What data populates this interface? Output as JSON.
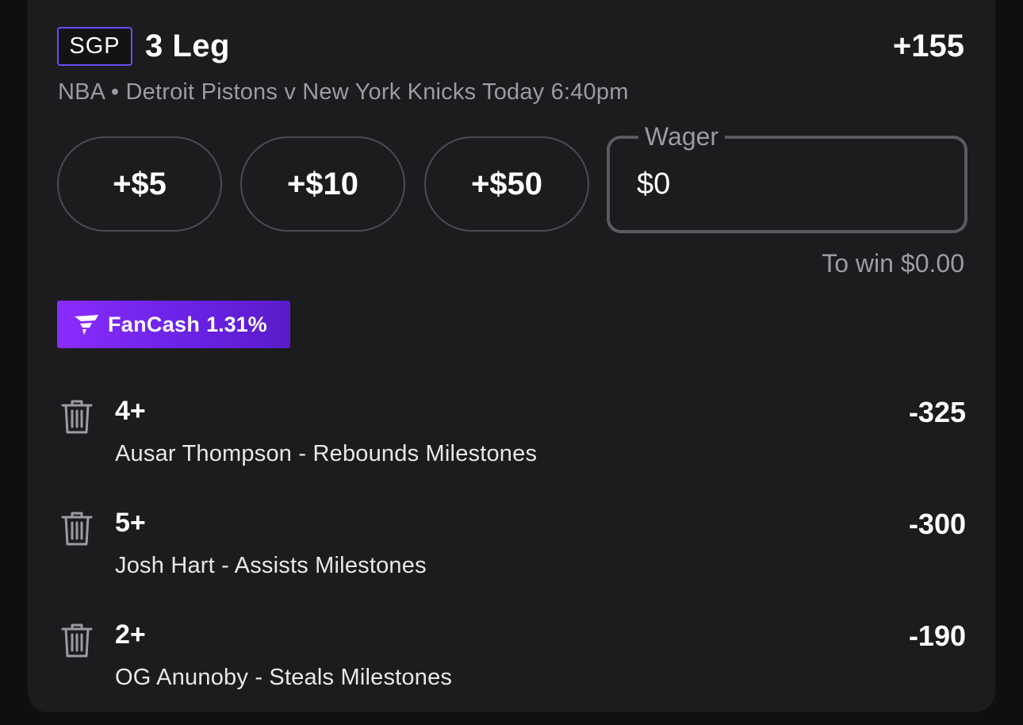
{
  "header": {
    "badge": "SGP",
    "title": "3 Leg",
    "odds": "+155",
    "subtitle": "NBA • Detroit Pistons v New York Knicks Today 6:40pm"
  },
  "wager": {
    "quick_amounts": [
      "+$5",
      "+$10",
      "+$50"
    ],
    "label": "Wager",
    "value": "$0",
    "to_win_label": "To win",
    "to_win_value": "$0.00"
  },
  "fancash": {
    "label": "FanCash",
    "value": "1.31%"
  },
  "legs": [
    {
      "line": "4+",
      "description": "Ausar Thompson - Rebounds Milestones",
      "odds": "-325"
    },
    {
      "line": "5+",
      "description": "Josh Hart - Assists Milestones",
      "odds": "-300"
    },
    {
      "line": "2+",
      "description": "OG Anunoby - Steals Milestones",
      "odds": "-190"
    }
  ],
  "colors": {
    "background": "#0f0f10",
    "card": "#1c1c1e",
    "sgp_border": "#6c4cf2",
    "fancash_gradient_start": "#8a2cff",
    "fancash_gradient_end": "#5a1cc9",
    "muted_text": "#9b9ba1"
  },
  "icons": {
    "leg_remove": "trash-icon",
    "fancash": "fancash-logo-icon"
  }
}
